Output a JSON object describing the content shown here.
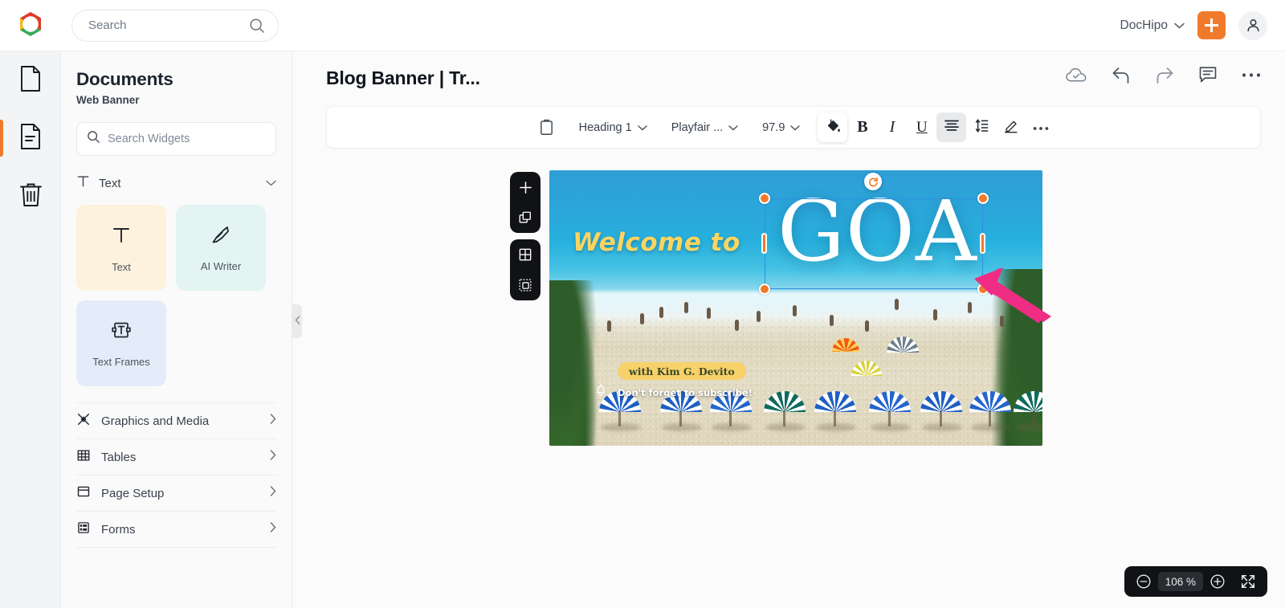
{
  "topbar": {
    "search": {
      "value": "",
      "placeholder": "Search",
      "icon": "search-icon"
    },
    "workspace": {
      "label": "DocHipo",
      "chevron": "chevron-down-icon"
    },
    "add_label": "+",
    "logo": "dochipo-logo-icon",
    "avatar": "user-avatar-icon"
  },
  "rail": {
    "items": [
      {
        "name": "documents",
        "icon": "file-blank-icon",
        "active": false
      },
      {
        "name": "pages",
        "icon": "file-lines-icon",
        "active": true
      },
      {
        "name": "trash",
        "icon": "trash-icon",
        "active": false
      }
    ]
  },
  "panel": {
    "title": "Documents",
    "subtitle": "Web Banner",
    "search": {
      "value": "",
      "placeholder": "Search Widgets",
      "icon": "search-icon"
    },
    "section": {
      "label": "Text",
      "icon": "text-t-icon",
      "chevron": "chevron-down-icon",
      "expanded": true
    },
    "tiles": [
      {
        "label": "Text",
        "icon": "text-t-icon",
        "color": "#fcf2dd"
      },
      {
        "label": "AI Writer",
        "icon": "pen-nib-icon",
        "color": "#e3f4f2"
      },
      {
        "label": "Text Frames",
        "icon": "text-frame-icon",
        "color": "#e4ecf9"
      }
    ],
    "menu": [
      {
        "label": "Graphics and Media",
        "icon": "graphics-media-icon",
        "chevron": "chevron-right-icon"
      },
      {
        "label": "Tables",
        "icon": "table-grid-icon",
        "chevron": "chevron-right-icon"
      },
      {
        "label": "Page Setup",
        "icon": "page-setup-icon",
        "chevron": "chevron-right-icon"
      },
      {
        "label": "Forms",
        "icon": "forms-icon",
        "chevron": "chevron-right-icon"
      }
    ],
    "collapse": {
      "icon": "chevron-left-icon"
    }
  },
  "editor": {
    "doc_title": "Blog Banner | Tr...",
    "actions": [
      {
        "name": "save-status",
        "icon": "cloud-check-icon"
      },
      {
        "name": "undo",
        "icon": "undo-arrow-icon"
      },
      {
        "name": "redo",
        "icon": "redo-arrow-icon"
      },
      {
        "name": "comments",
        "icon": "comment-icon"
      },
      {
        "name": "more-options",
        "icon": "ellipsis-icon"
      }
    ],
    "format_bar": {
      "clipboard_icon": "clipboard-icon",
      "style": {
        "value": "Heading 1",
        "chevron": "chevron-down-icon"
      },
      "font": {
        "value": "Playfair ...",
        "chevron": "chevron-down-icon"
      },
      "size": {
        "value": "97.9",
        "chevron": "chevron-down-icon"
      },
      "fill": {
        "icon": "paint-bucket-icon",
        "active": true
      },
      "bold": {
        "label": "B",
        "active": false
      },
      "italic": {
        "label": "I",
        "active": false
      },
      "underline": {
        "label": "U",
        "active": false
      },
      "align": {
        "icon": "align-center-icon",
        "active": true
      },
      "line_height": {
        "icon": "line-height-icon",
        "active": false
      },
      "highlight": {
        "icon": "marker-pen-icon",
        "active": false
      },
      "more": {
        "icon": "ellipsis-icon",
        "active": false
      }
    },
    "page_tools": [
      {
        "name": "add-page",
        "icon": "plus-icon"
      },
      {
        "name": "duplicate-page",
        "icon": "copy-layers-icon"
      },
      {
        "name": "grid-view",
        "icon": "grid-icon"
      },
      {
        "name": "select-area",
        "icon": "dashed-select-icon"
      }
    ],
    "selection": {
      "rotate_icon": "rotate-icon",
      "handle_color": "#f07a2b",
      "outline_color": "#2d8fe0"
    },
    "pointer": {
      "icon": "arrow-cursor-icon",
      "color": "#ef2d84"
    }
  },
  "banner": {
    "headline_prefix": "Welcome to",
    "headline_main": "GOA",
    "byline": "with Kim G. Devito",
    "subscribe_text": "Don't forget to subscribe!",
    "bell_icon": "bell-icon",
    "prefix_color": "#fcd45f",
    "pill_color": "#f7d16a"
  },
  "zoom": {
    "out_icon": "minus-circle-icon",
    "value": "106 %",
    "in_icon": "plus-circle-icon",
    "fullscreen_icon": "expand-arrows-icon"
  }
}
